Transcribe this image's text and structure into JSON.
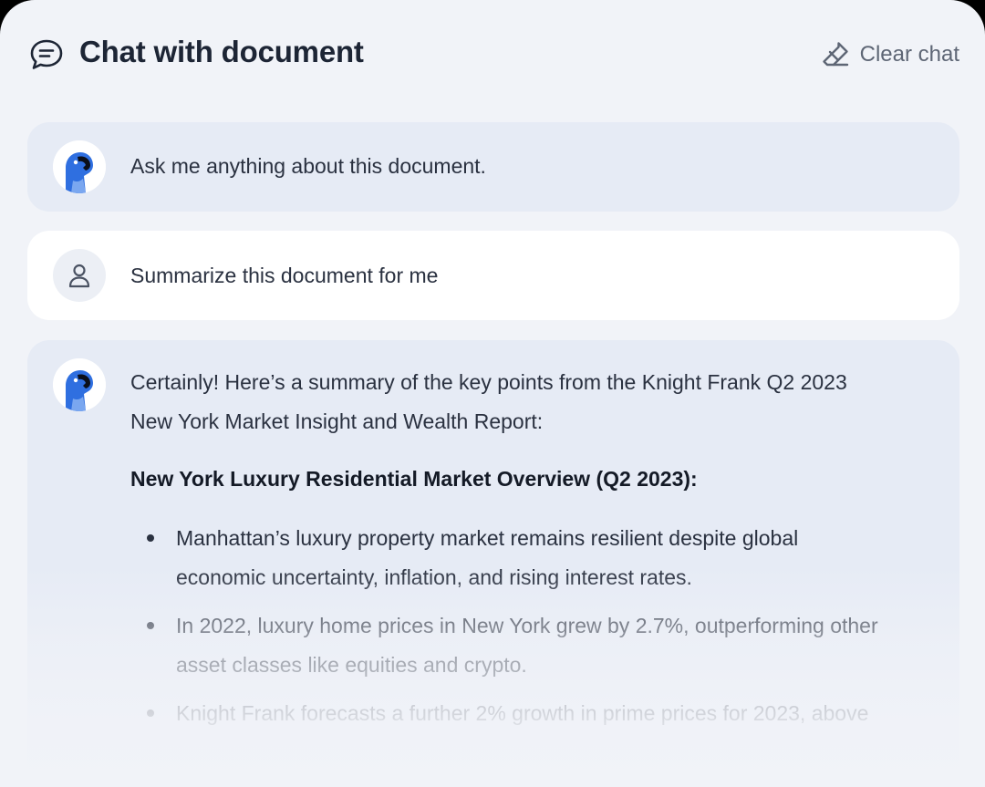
{
  "header": {
    "title": "Chat with document",
    "clear_label": "Clear chat"
  },
  "messages": [
    {
      "role": "bot",
      "text": "Ask me anything about this document."
    },
    {
      "role": "user",
      "text": "Summarize this document for me"
    },
    {
      "role": "bot",
      "intro_line1": "Certainly! Here’s a summary of the key points from the Knight Frank Q2 2023",
      "intro_line2": "New York Market Insight and Wealth Report:",
      "heading": "New York Luxury Residential Market Overview (Q2 2023):",
      "bullets": [
        {
          "line1": "Manhattan’s luxury property market remains resilient despite global",
          "line2": "economic uncertainty, inflation, and rising interest rates."
        },
        {
          "line1": "In 2022, luxury home prices in New York grew by 2.7%, outperforming other",
          "line2": "asset classes like equities and crypto."
        },
        {
          "line1": "Knight Frank forecasts a further 2% growth in prime prices for 2023, above",
          "line2": ""
        }
      ]
    }
  ],
  "colors": {
    "background": "#f1f3f8",
    "bot_bubble": "#e6ebf5",
    "user_bubble": "#ffffff",
    "avatar_blue": "#2f6fe0",
    "title": "#1d2535"
  },
  "icons": {
    "header": "chat-bubble-icon",
    "clear": "eraser-icon",
    "bot": "parrot-avatar-icon",
    "user": "user-icon"
  }
}
